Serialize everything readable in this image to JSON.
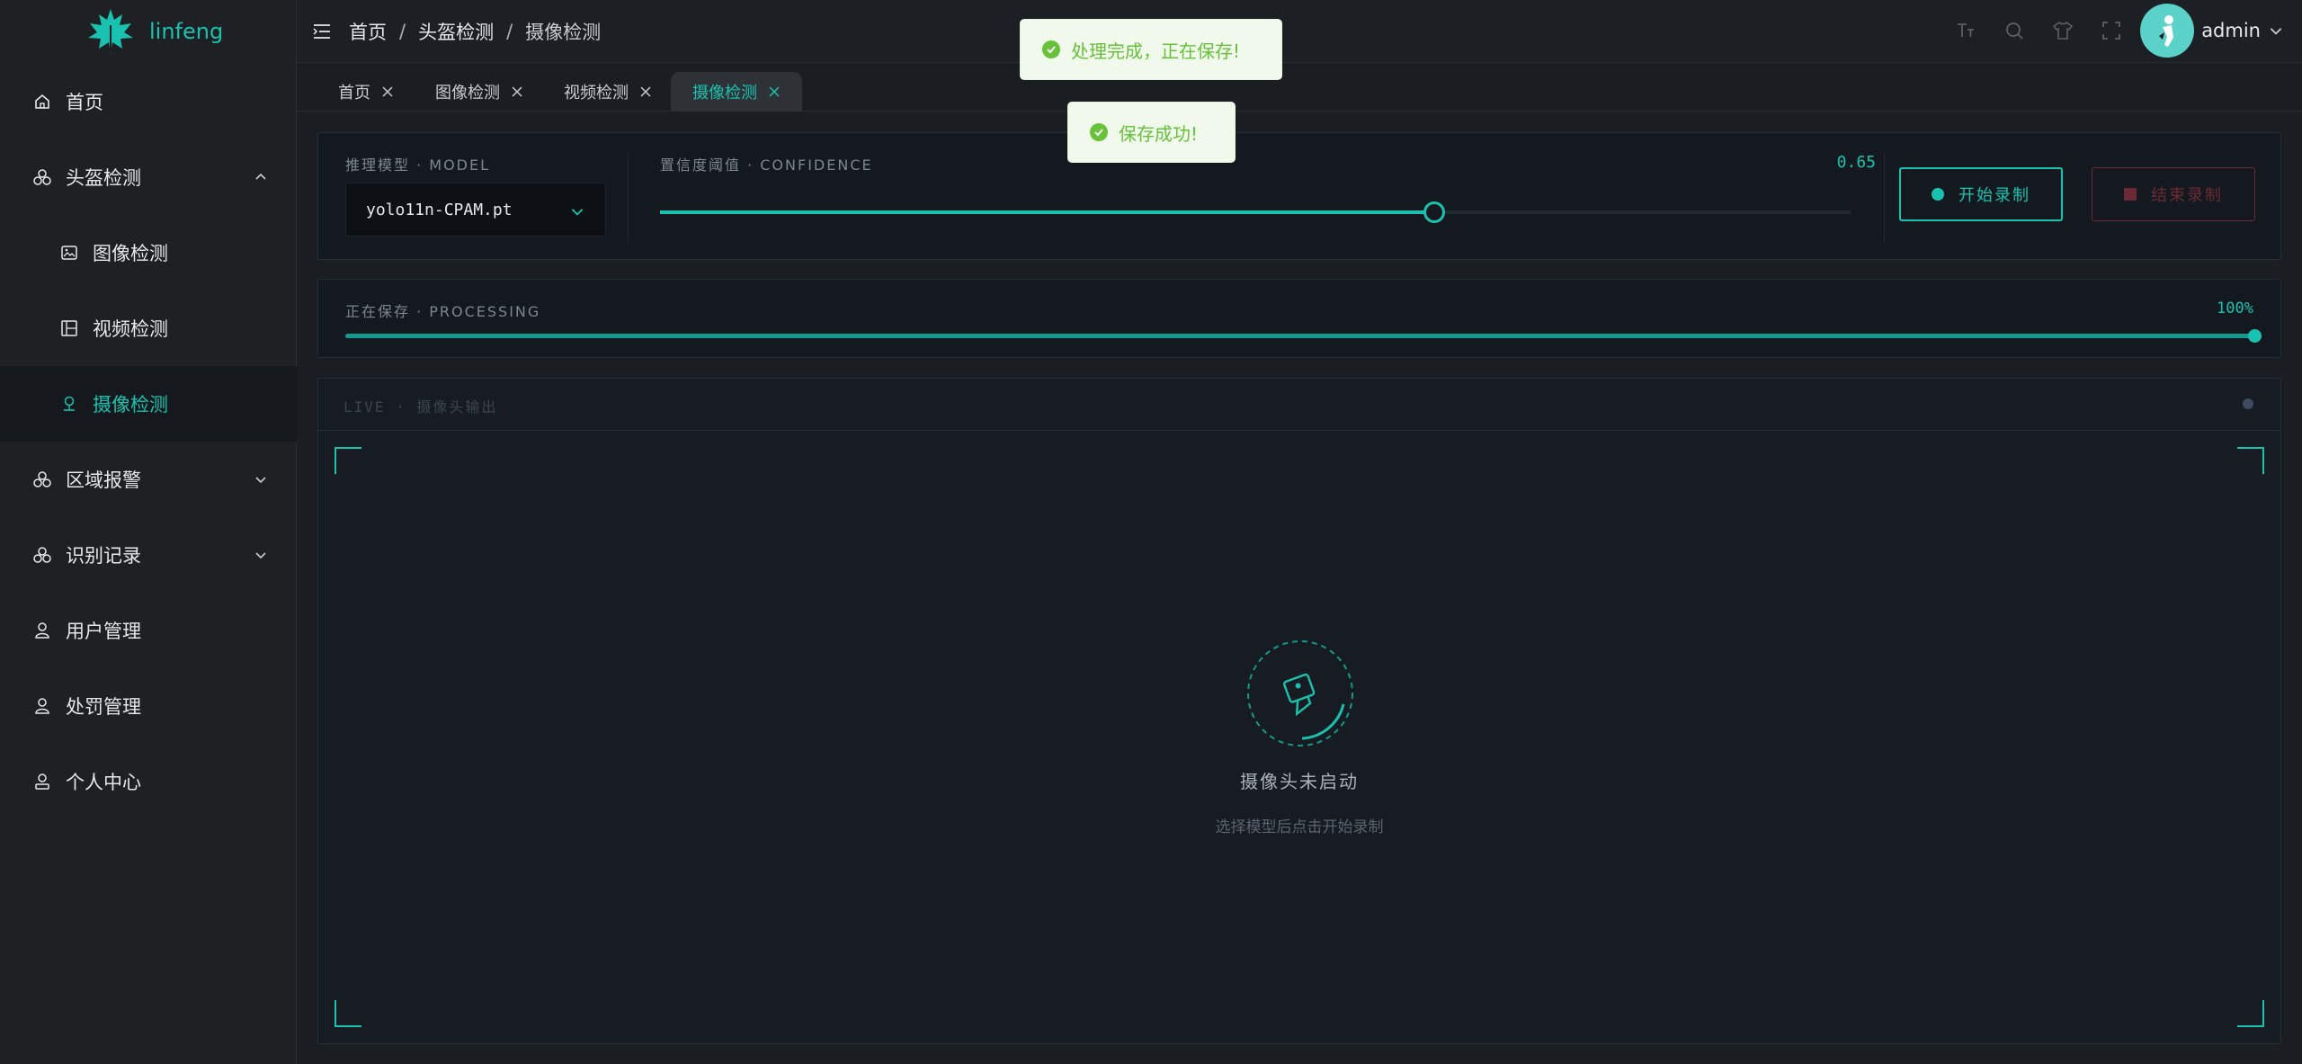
{
  "app": {
    "brand": "linfeng"
  },
  "sidebar": {
    "items": [
      {
        "label": "首页"
      },
      {
        "label": "头盔检测"
      },
      {
        "label": "图像检测"
      },
      {
        "label": "视频检测"
      },
      {
        "label": "摄像检测"
      },
      {
        "label": "区域报警"
      },
      {
        "label": "识别记录"
      },
      {
        "label": "用户管理"
      },
      {
        "label": "处罚管理"
      },
      {
        "label": "个人中心"
      }
    ]
  },
  "header": {
    "breadcrumb": [
      "首页",
      "头盔检测",
      "摄像检测"
    ],
    "separator": "/",
    "user": "admin"
  },
  "tabs": [
    {
      "label": "首页"
    },
    {
      "label": "图像检测"
    },
    {
      "label": "视频检测"
    },
    {
      "label": "摄像检测"
    }
  ],
  "toasts": [
    "处理完成，正在保存!",
    "保存成功!"
  ],
  "controls": {
    "model_caption": "推理模型 · MODEL",
    "model_value": "yolo11n-CPAM.pt",
    "confidence_caption": "置信度阈值 · CONFIDENCE",
    "confidence_value": "0.65",
    "confidence": 0.65,
    "start_label": "开始录制",
    "stop_label": "结束录制"
  },
  "processing": {
    "caption": "正在保存 · PROCESSING",
    "percent_label": "100%",
    "percent": 100
  },
  "live": {
    "caption": "LIVE · 摄像头输出",
    "status": "摄像头未启动",
    "hint": "选择模型后点击开始录制"
  },
  "colors": {
    "accent": "#19c2b0",
    "danger": "#6b2a35",
    "success": "#67c23a"
  }
}
